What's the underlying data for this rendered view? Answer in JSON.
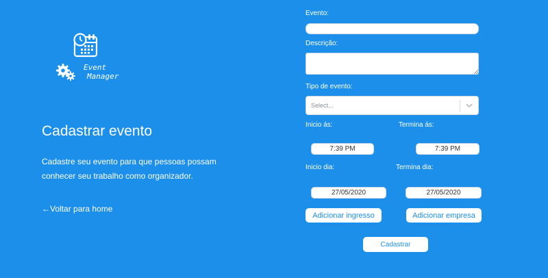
{
  "brand": {
    "logo_line1": "Event",
    "logo_line2": "Manager",
    "icons": [
      "calendar-clock-icon",
      "gears-icon"
    ]
  },
  "intro": {
    "title": "Cadastrar evento",
    "description": "Cadastre seu evento para que pessoas possam conhecer seu trabalho como organizador.",
    "back_link": "←Voltar para home"
  },
  "form": {
    "evento_label": "Evento:",
    "evento_value": "",
    "descricao_label": "Descrição:",
    "descricao_value": "",
    "tipo_label": "Tipo de evento:",
    "tipo_placeholder": "Select...",
    "inicio_hora_label": "Inicio ás:",
    "inicio_hora_value": "7:39 PM",
    "termino_hora_label": "Termina ás:",
    "termino_hora_value": "7:39 PM",
    "inicio_dia_label": "Inicio dia:",
    "inicio_dia_value": "27/05/2020",
    "termino_dia_label": "Termina dia:",
    "termino_dia_value": "27/05/2020",
    "add_ingresso_label": "Adicionar ingresso",
    "add_empresa_label": "Adicionar empresa",
    "submit_label": "Cadastrar"
  },
  "colors": {
    "background": "#1c8fea",
    "button_text": "#1c8fea",
    "field_bg": "#ffffff"
  }
}
